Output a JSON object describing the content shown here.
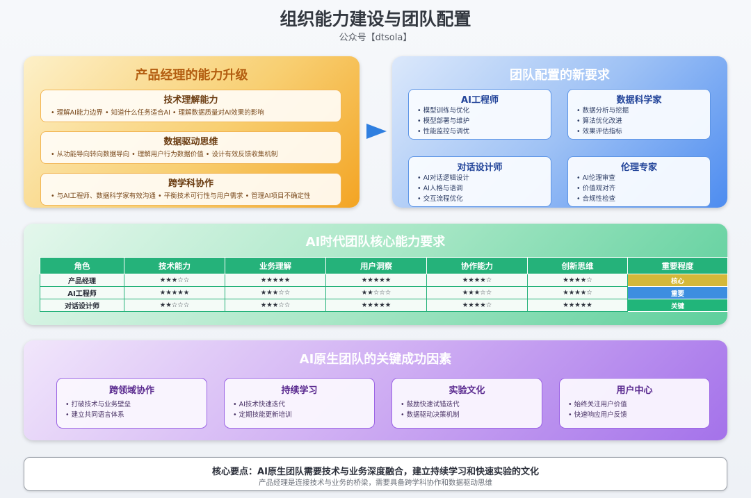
{
  "header": {
    "title": "组织能力建设与团队配置",
    "subtitle": "公众号【dtsola】"
  },
  "pm_panel": {
    "title": "产品经理的能力升级",
    "cards": [
      {
        "title": "技术理解能力",
        "desc": "• 理解AI能力边界 • 知道什么任务适合AI • 理解数据质量对AI效果的影响"
      },
      {
        "title": "数据驱动思维",
        "desc": "• 从功能导向转向数据导向 • 理解用户行为数据价值 • 设计有效反馈收集机制"
      },
      {
        "title": "跨学科协作",
        "desc": "• 与AI工程师、数据科学家有效沟通 • 平衡技术可行性与用户需求 • 管理AI项目不确定性"
      }
    ],
    "accent_color": "#f3a423"
  },
  "team_panel": {
    "title": "团队配置的新要求",
    "roles": [
      {
        "title": "AI工程师",
        "items": [
          "• 模型训练与优化",
          "• 模型部署与维护",
          "• 性能监控与调优"
        ]
      },
      {
        "title": "数据科学家",
        "items": [
          "• 数据分析与挖掘",
          "• 算法优化改进",
          "• 效果评估指标"
        ]
      },
      {
        "title": "对话设计师",
        "items": [
          "• AI对话逻辑设计",
          "• AI人格与语调",
          "• 交互流程优化"
        ]
      },
      {
        "title": "伦理专家",
        "items": [
          "• AI伦理审查",
          "• 价值观对齐",
          "• 合规性检查"
        ]
      }
    ],
    "accent_color": "#4d8cf0"
  },
  "capability_panel": {
    "title": "AI时代团队核心能力要求",
    "headers": [
      "角色",
      "技术能力",
      "业务理解",
      "用户洞察",
      "协作能力",
      "创新思维",
      "重要程度"
    ],
    "rows": [
      {
        "cells": [
          "产品经理",
          "★★★☆☆",
          "★★★★★",
          "★★★★★",
          "★★★★☆",
          "★★★★☆"
        ],
        "importance": "核心",
        "importance_color": "#d4b83a"
      },
      {
        "cells": [
          "AI工程师",
          "★★★★★",
          "★★★☆☆",
          "★★☆☆☆",
          "★★★☆☆",
          "★★★★☆"
        ],
        "importance": "重要",
        "importance_color": "#3d8ee0"
      },
      {
        "cells": [
          "对话设计师",
          "★★☆☆☆",
          "★★★☆☆",
          "★★★★★",
          "★★★★☆",
          "★★★★★"
        ],
        "importance": "关键",
        "importance_color": "#21b57a"
      }
    ],
    "accent_color": "#25b27a"
  },
  "factor_panel": {
    "title": "AI原生团队的关键成功因素",
    "cards": [
      {
        "title": "跨领域协作",
        "items": [
          "• 打破技术与业务壁垒",
          "• 建立共同语言体系"
        ]
      },
      {
        "title": "持续学习",
        "items": [
          "• AI技术快速迭代",
          "• 定期技能更新培训"
        ]
      },
      {
        "title": "实验文化",
        "items": [
          "• 鼓励快速试错迭代",
          "• 数据驱动决策机制"
        ]
      },
      {
        "title": "用户中心",
        "items": [
          "• 始终关注用户价值",
          "• 快速响应用户反馈"
        ]
      }
    ],
    "accent_color": "#a472ea"
  },
  "summary": {
    "main": "核心要点：AI原生团队需要技术与业务深度融合，建立持续学习和快速实验的文化",
    "sub": "产品经理是连接技术与业务的桥梁，需要具备跨学科协作和数据驱动思维"
  }
}
